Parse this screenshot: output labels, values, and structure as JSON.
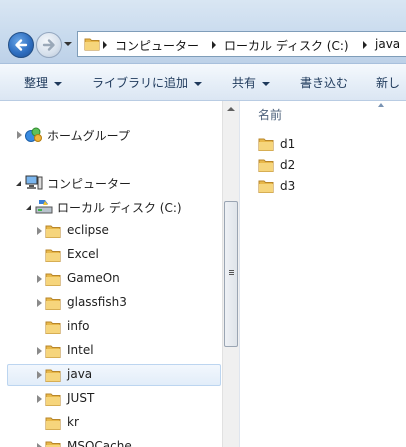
{
  "address": {
    "crumbs": [
      "コンピューター",
      "ローカル ディスク (C:)",
      "java"
    ]
  },
  "toolbar": {
    "organize": "整理",
    "library": "ライブラリに追加",
    "share": "共有",
    "burn": "書き込む",
    "new": "新し"
  },
  "tree": {
    "homegroup": "ホームグループ",
    "computer": "コンピューター",
    "local_disk": "ローカル ディスク (C:)",
    "folders": [
      "eclipse",
      "Excel",
      "GameOn",
      "glassfish3",
      "info",
      "Intel",
      "java",
      "JUST",
      "kr",
      "MSOCache"
    ]
  },
  "content": {
    "column_name": "名前",
    "items": [
      "d1",
      "d2",
      "d3"
    ]
  },
  "colors": {
    "selection_bg": "#e2edf9",
    "folder": "#e8b84a",
    "toolbar_text": "#1e395b"
  }
}
